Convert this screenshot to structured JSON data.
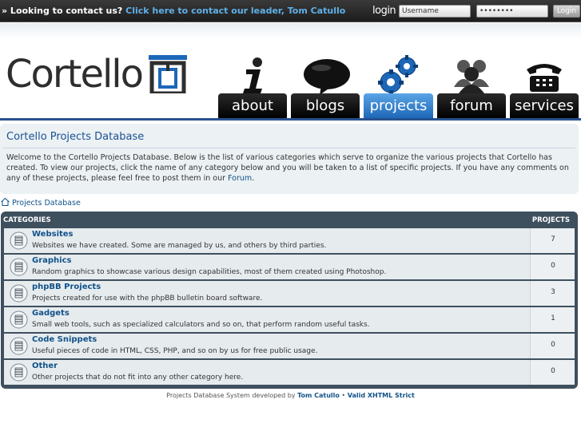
{
  "topbar": {
    "contact_prefix": "» Looking to contact us?",
    "contact_link": "Click here to contact our leader, Tom Catullo",
    "login_label": "login",
    "username_value": "Username",
    "password_value": "••••••••",
    "login_button": "Login"
  },
  "header": {
    "logo_text": "Cortello",
    "nav": [
      {
        "label": "about",
        "icon": "info-icon"
      },
      {
        "label": "blogs",
        "icon": "speech-bubble-icon"
      },
      {
        "label": "projects",
        "icon": "gears-icon"
      },
      {
        "label": "forum",
        "icon": "users-icon"
      },
      {
        "label": "services",
        "icon": "phone-icon"
      }
    ]
  },
  "info": {
    "title": "Cortello Projects Database",
    "text": "Welcome to the Cortello Projects Database. Below is the list of various categories which serve to organize the various projects that Cortello has created. To view our projects, click the name of any category below and you will be taken to a list of specific projects. If you have any comments on any of these projects, please feel free to post them in our ",
    "forum_link": "Forum",
    "text_end": "."
  },
  "breadcrumb": "Projects Database",
  "categories": {
    "header_left": "CATEGORIES",
    "header_right": "PROJECTS",
    "items": [
      {
        "title": "Websites",
        "desc": "Websites we have created. Some are managed by us, and others by third parties.",
        "count": "7"
      },
      {
        "title": "Graphics",
        "desc": "Random graphics to showcase various design capabilities, most of them created using Photoshop.",
        "count": "0"
      },
      {
        "title": "phpBB Projects",
        "desc": "Projects created for use with the phpBB bulletin board software.",
        "count": "3"
      },
      {
        "title": "Gadgets",
        "desc": "Small web tools, such as specialized calculators and so on, that perform random useful tasks.",
        "count": "1"
      },
      {
        "title": "Code Snippets",
        "desc": "Useful pieces of code in HTML, CSS, PHP, and so on by us for free public usage.",
        "count": "0"
      },
      {
        "title": "Other",
        "desc": "Other projects that do not fit into any other category here.",
        "count": "0"
      }
    ]
  },
  "footer": {
    "prefix": "Projects Database System developed by",
    "author": "Tom Catullo",
    "separator": "•",
    "valid_link": "Valid XHTML Strict"
  },
  "colors": {
    "accent": "#1d67b8",
    "link": "#105289",
    "panel": "#3e4f5e"
  }
}
